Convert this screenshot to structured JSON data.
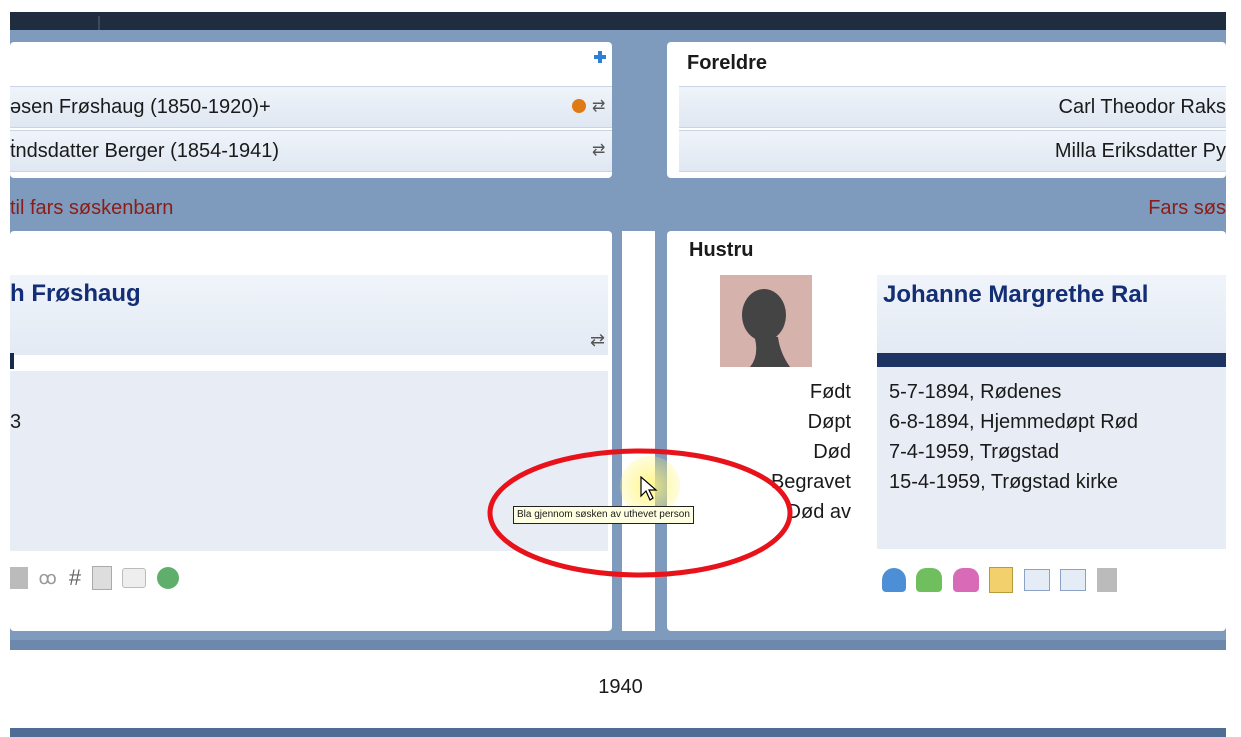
{
  "parents_left": {
    "row1": "əsen Frøshaug (1850-1920)+",
    "row2": "ṫndsdatter Berger (1854-1941)"
  },
  "parents_right": {
    "label": "Foreldre",
    "row1": "Carl Theodor Raks",
    "row2": "Milla Eriksdatter Py"
  },
  "cousin_bar": {
    "left": "til fars søskenbarn",
    "right": "Fars søs"
  },
  "left_person": {
    "name": "h Frøshaug",
    "fragment": "3"
  },
  "spouse": {
    "label": "Hustru",
    "name": "Johanne Margrethe Ral",
    "facts": [
      {
        "label": "Født",
        "value": "5-7-1894, Rødenes"
      },
      {
        "label": "Døpt",
        "value": "6-8-1894, Hjemmedøpt Rød"
      },
      {
        "label": "Død",
        "value": "7-4-1959, Trøgstad"
      },
      {
        "label": "Begravet",
        "value": "15-4-1959, Trøgstad kirke"
      },
      {
        "label": "Død av",
        "value": ""
      }
    ]
  },
  "tooltip": "Bla gjennom søsken av uthevet person",
  "timeline_year": "1940",
  "colors": {
    "frame": "#7e9bbd",
    "topbar": "#1f2d3f",
    "accent_red": "#e8121b",
    "name_navy": "#132e74",
    "cousin_text": "#8b1d16"
  },
  "icons": {
    "add": "plus-icon",
    "swap": "swap-arrows-icon",
    "info": "info-badge-icon",
    "silhouette": "person-silhouette-icon"
  }
}
